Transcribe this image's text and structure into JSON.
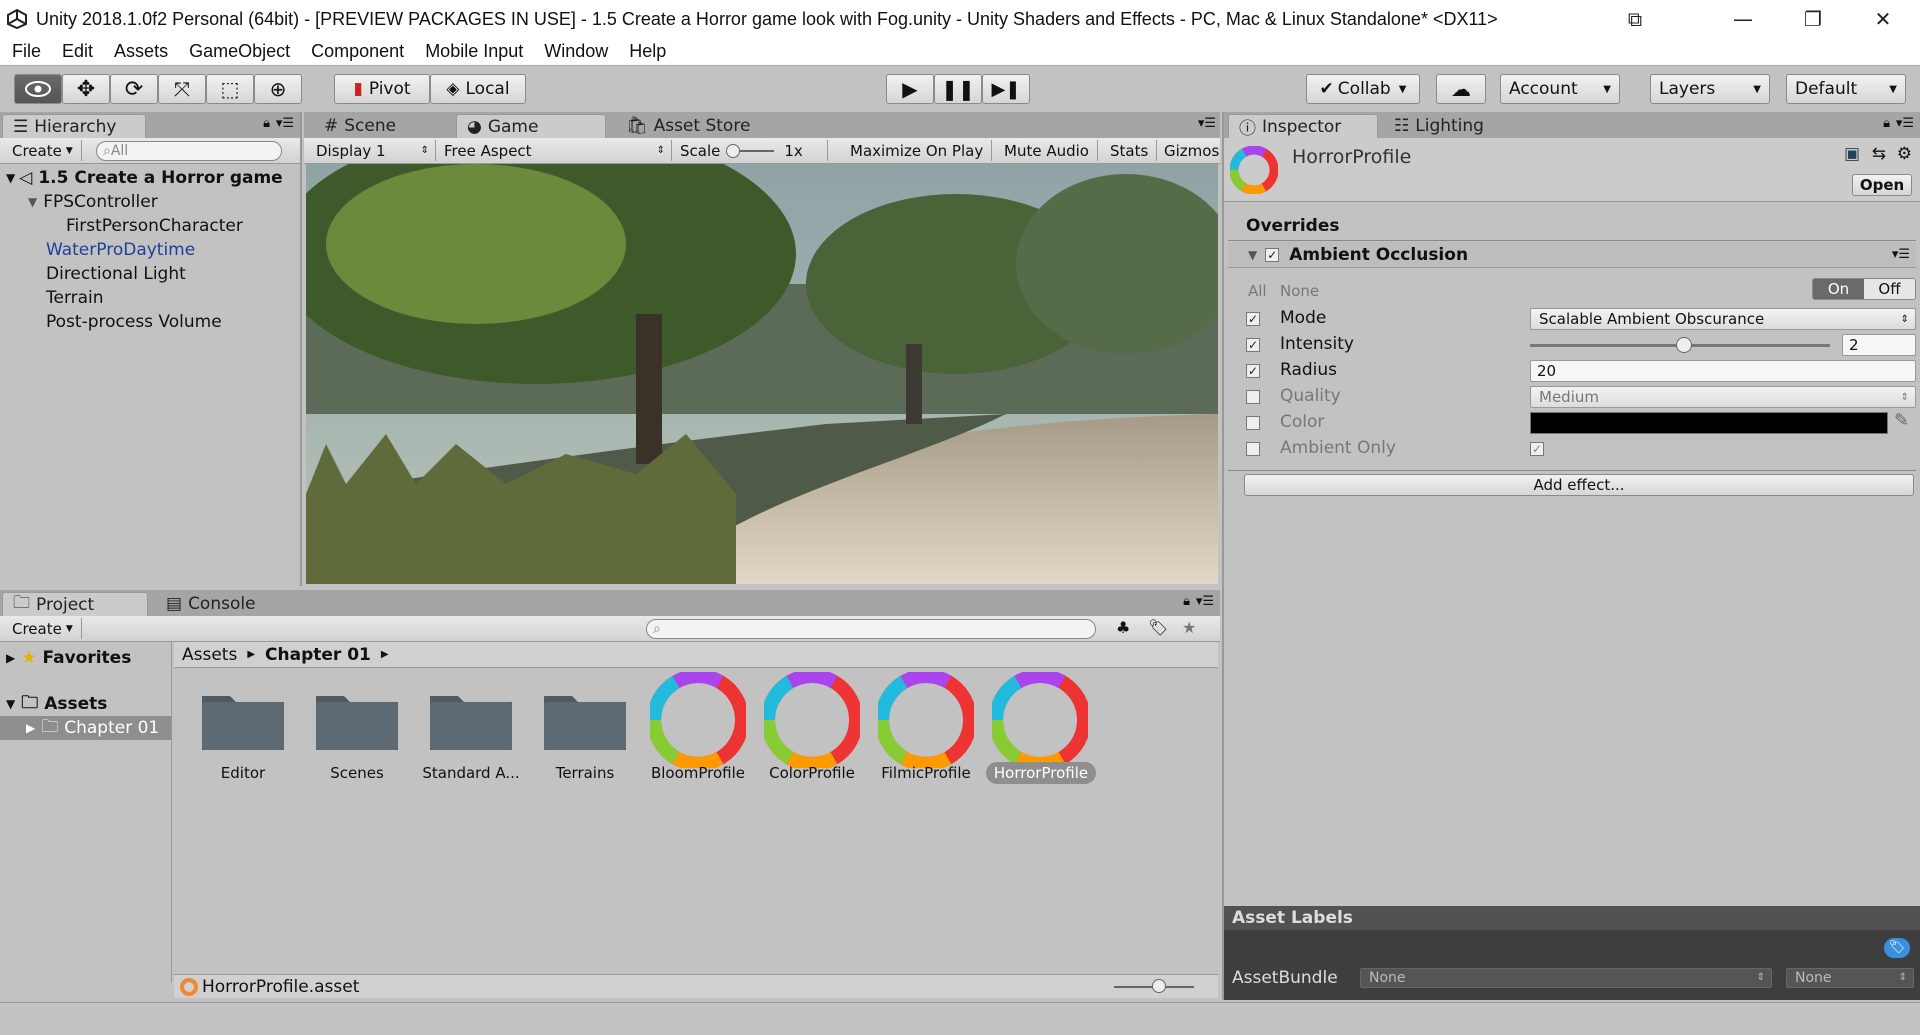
{
  "window": {
    "title": "Unity 2018.1.0f2 Personal (64bit) - [PREVIEW PACKAGES IN USE] - 1.5 Create a Horror game look with Fog.unity - Unity Shaders and Effects - PC, Mac & Linux Standalone* <DX11>"
  },
  "menu": [
    "File",
    "Edit",
    "Assets",
    "GameObject",
    "Component",
    "Mobile Input",
    "Window",
    "Help"
  ],
  "toolbar": {
    "pivot": "Pivot",
    "local": "Local",
    "collab": "Collab",
    "account": "Account",
    "layers": "Layers",
    "layout": "Default"
  },
  "hierarchy": {
    "tab": "Hierarchy",
    "create": "Create",
    "search_placeholder": "All",
    "scene": "1.5 Create a Horror game",
    "items": [
      "FPSController",
      "FirstPersonCharacter",
      "WaterProDaytime",
      "Directional Light",
      "Terrain",
      "Post-process Volume"
    ]
  },
  "game": {
    "tabs": [
      "Scene",
      "Game",
      "Asset Store"
    ],
    "display": "Display 1",
    "aspect": "Free Aspect",
    "scale_label": "Scale",
    "scale_value": "1x",
    "maximize": "Maximize On Play",
    "mute": "Mute Audio",
    "stats": "Stats",
    "gizmos": "Gizmos"
  },
  "project": {
    "tabs": [
      "Project",
      "Console"
    ],
    "create": "Create",
    "favorites": "Favorites",
    "assets": "Assets",
    "chapter": "Chapter 01",
    "breadcrumb": [
      "Assets",
      "Chapter 01"
    ],
    "items": [
      {
        "name": "Editor",
        "kind": "folder"
      },
      {
        "name": "Scenes",
        "kind": "folder"
      },
      {
        "name": "Standard A...",
        "kind": "folder"
      },
      {
        "name": "Terrains",
        "kind": "folder"
      },
      {
        "name": "BloomProfile",
        "kind": "profile"
      },
      {
        "name": "ColorProfile",
        "kind": "profile"
      },
      {
        "name": "FilmicProfile",
        "kind": "profile"
      },
      {
        "name": "HorrorProfile",
        "kind": "profile"
      }
    ],
    "footer": "HorrorProfile.asset"
  },
  "inspector": {
    "tabs": [
      "Inspector",
      "Lighting"
    ],
    "asset_name": "HorrorProfile",
    "open": "Open",
    "overrides": "Overrides",
    "effect": "Ambient Occlusion",
    "all": "All",
    "none": "None",
    "on": "On",
    "off": "Off",
    "props": [
      {
        "label": "Mode",
        "value": "Scalable Ambient Obscurance",
        "checked": true
      },
      {
        "label": "Intensity",
        "value": "2",
        "checked": true
      },
      {
        "label": "Radius",
        "value": "20",
        "checked": true
      },
      {
        "label": "Quality",
        "value": "Medium",
        "checked": false
      },
      {
        "label": "Color",
        "value": "",
        "checked": false
      },
      {
        "label": "Ambient Only",
        "value": "",
        "checked": false
      }
    ],
    "add_effect": "Add effect...",
    "asset_labels": "Asset Labels",
    "assetbundle": "AssetBundle",
    "bundle_none": "None",
    "variant_none": "None"
  },
  "colors": {
    "selected_text": "#1f3f9a",
    "panel": "#c2c2c2",
    "dark_header": "#525252"
  }
}
